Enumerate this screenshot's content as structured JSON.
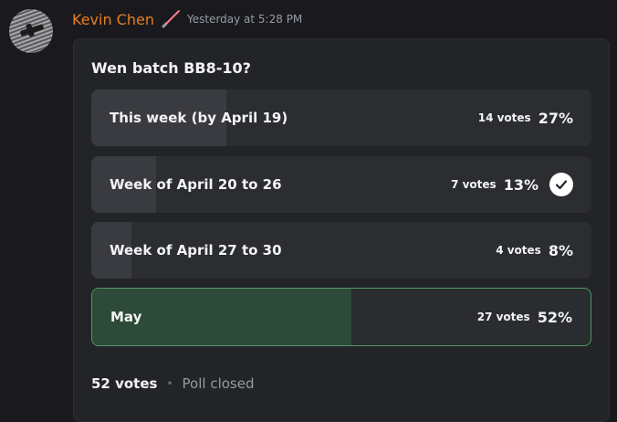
{
  "message": {
    "author": "Kevin Chen",
    "timestamp": "Yesterday at 5:28 PM",
    "author_color": "#e67e22",
    "role_icon": "lightsaber-icon"
  },
  "poll": {
    "question": "Wen batch BB8-10?",
    "answers": [
      {
        "label": "This week (by April 19)",
        "votes": "14 votes",
        "percent": "27%",
        "fraction": 0.27
      },
      {
        "label": "Week of April 20 to 26",
        "votes": "7 votes",
        "percent": "13%",
        "fraction": 0.13,
        "selected": true
      },
      {
        "label": "Week of April 27 to 30",
        "votes": "4 votes",
        "percent": "8%",
        "fraction": 0.08
      },
      {
        "label": "May",
        "votes": "27 votes",
        "percent": "52%",
        "fraction": 0.52,
        "winner": true
      }
    ],
    "total_votes": "52 votes",
    "separator": "•",
    "status": "Poll closed",
    "winner_color": "#4e9a66"
  }
}
